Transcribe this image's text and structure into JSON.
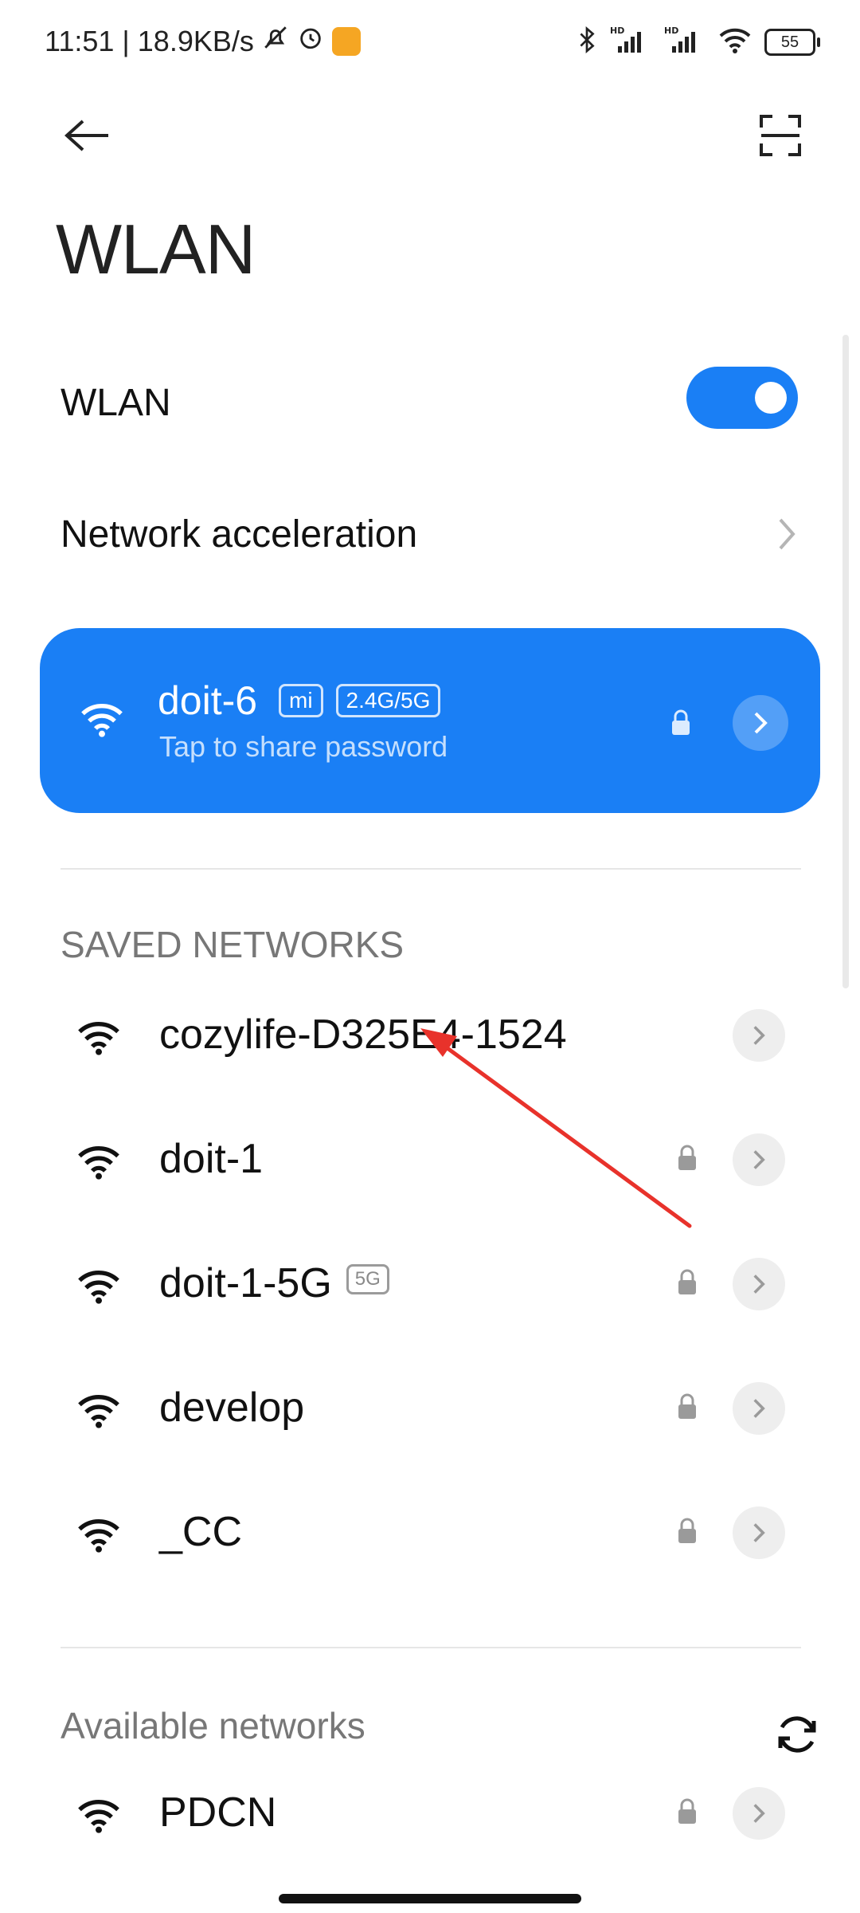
{
  "status_bar": {
    "time_speed": "11:51 | 18.9KB/s",
    "battery": "55",
    "icons": [
      "mute-icon",
      "alarm-icon",
      "app-notification-icon",
      "bluetooth-icon",
      "hd-signal-icon",
      "hd-signal-icon",
      "wifi-icon",
      "battery-icon"
    ]
  },
  "header": {
    "title": "WLAN",
    "back_icon": "arrow-left-icon",
    "scan_icon": "scan-icon"
  },
  "settings": {
    "wlan_label": "WLAN",
    "wlan_enabled": true,
    "network_acceleration_label": "Network acceleration"
  },
  "connected": {
    "name": "doit-6",
    "badge_mi": "mi",
    "badge_band": "2.4G/5G",
    "subtitle": "Tap to share password"
  },
  "saved_networks": {
    "title": "SAVED NETWORKS",
    "items": [
      {
        "name": "cozylife-D325E4-1524",
        "badge": "",
        "locked": false
      },
      {
        "name": "doit-1",
        "badge": "",
        "locked": true
      },
      {
        "name": "doit-1-5G",
        "badge": "5G",
        "locked": true
      },
      {
        "name": "develop",
        "badge": "",
        "locked": true
      },
      {
        "name": "_CC",
        "badge": "",
        "locked": true
      }
    ]
  },
  "available_networks": {
    "title": "Available networks",
    "items": [
      {
        "name": "PDCN",
        "badge": "",
        "locked": true
      }
    ]
  },
  "colors": {
    "accent": "#1a7ff5",
    "annotation_arrow": "#e8322b"
  }
}
